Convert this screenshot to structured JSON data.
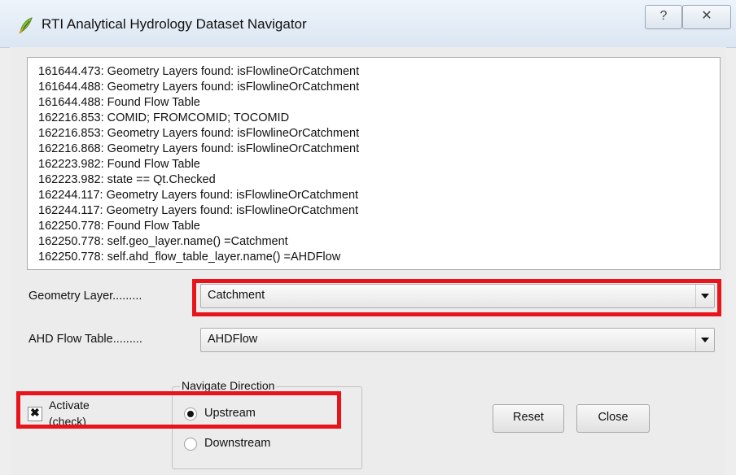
{
  "window": {
    "title": "RTI Analytical Hydrology Dataset Navigator",
    "help_glyph": "?",
    "close_glyph": "✕"
  },
  "log": {
    "lines": [
      "161644.473: Geometry Layers found: isFlowlineOrCatchment",
      "161644.488: Geometry Layers found: isFlowlineOrCatchment",
      "161644.488: Found Flow Table",
      "162216.853: COMID; FROMCOMID; TOCOMID",
      "162216.853: Geometry Layers found: isFlowlineOrCatchment",
      "162216.868: Geometry Layers found: isFlowlineOrCatchment",
      "162223.982: Found Flow Table",
      "162223.982: state == Qt.Checked",
      "162244.117: Geometry Layers found: isFlowlineOrCatchment",
      "162244.117: Geometry Layers found: isFlowlineOrCatchment",
      "162250.778: Found Flow Table",
      "162250.778: self.geo_layer.name() =Catchment",
      "162250.778: self.ahd_flow_table_layer.name() =AHDFlow"
    ]
  },
  "geometry_layer": {
    "label": "Geometry Layer.........",
    "value": "Catchment"
  },
  "flow_table": {
    "label": "AHD Flow Table.........",
    "value": "AHDFlow"
  },
  "activate": {
    "label_line1": "Activate",
    "label_line2": "(check)",
    "checked": true,
    "mark": "✖"
  },
  "direction": {
    "title": "Navigate Direction",
    "options": [
      {
        "label": "Upstream",
        "selected": true
      },
      {
        "label": "Downstream",
        "selected": false
      }
    ]
  },
  "buttons": {
    "reset": "Reset",
    "close": "Close"
  },
  "colors": {
    "highlight": "#e8141c",
    "title_bar": "#dbe6f2",
    "dialog_bg": "#ececec"
  },
  "icons": [
    "qgis-leaf-icon",
    "help-icon",
    "close-icon",
    "dropdown-arrow-icon",
    "check-mark-icon"
  ]
}
